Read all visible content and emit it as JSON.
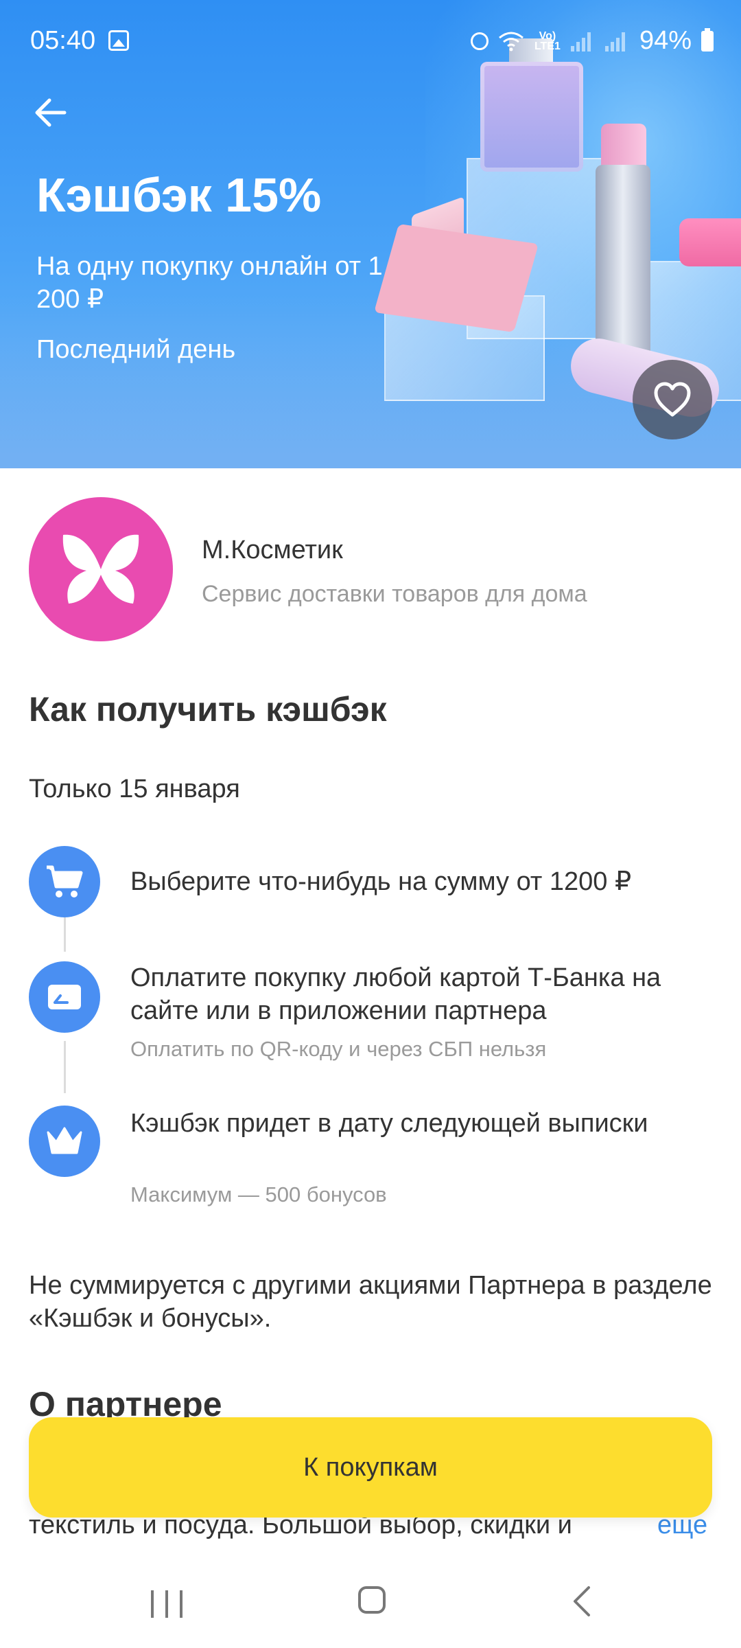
{
  "status_bar": {
    "time": "05:40",
    "battery": "94%",
    "icons": [
      "gallery-icon",
      "alarm-icon",
      "wifi-icon",
      "volte-icon",
      "signal-icon",
      "signal-icon",
      "battery-icon"
    ]
  },
  "hero": {
    "title": "Кэшбэк 15%",
    "subtitle": "На одну покупку онлайн от 1 200 ₽",
    "deadline": "Последний день",
    "colors": {
      "sky": "#2f8ff3",
      "logo_pink": "#e94bb0"
    }
  },
  "partner": {
    "name": "М.Косметик",
    "description": "Сервис доставки товаров для дома"
  },
  "how_to": {
    "title": "Как получить кэшбэк",
    "date_note": "Только 15 января",
    "steps": [
      {
        "icon": "cart-icon",
        "text": "Выберите что-нибудь на сумму от 1200 ₽",
        "note": ""
      },
      {
        "icon": "card-icon",
        "text": "Оплатите покупку любой картой Т-Банка на сайте или в приложении партнера",
        "note": "Оплатить по QR-коду и через СБП нельзя"
      },
      {
        "icon": "crown-icon",
        "text": "Кэшбэк придет в дату следующей выписки",
        "note": "Максимум — 500 бонусов"
      }
    ]
  },
  "terms_note": "Не суммируется с другими акциями Партнера в разделе «Кэшбэк и бонусы».",
  "about": {
    "title": "О партнере",
    "text_visible": "текстиль и посуда. Большой выбор, скидки и",
    "more_label": "еще"
  },
  "cta": {
    "label": "К покупкам",
    "color": "#fddd2e"
  }
}
